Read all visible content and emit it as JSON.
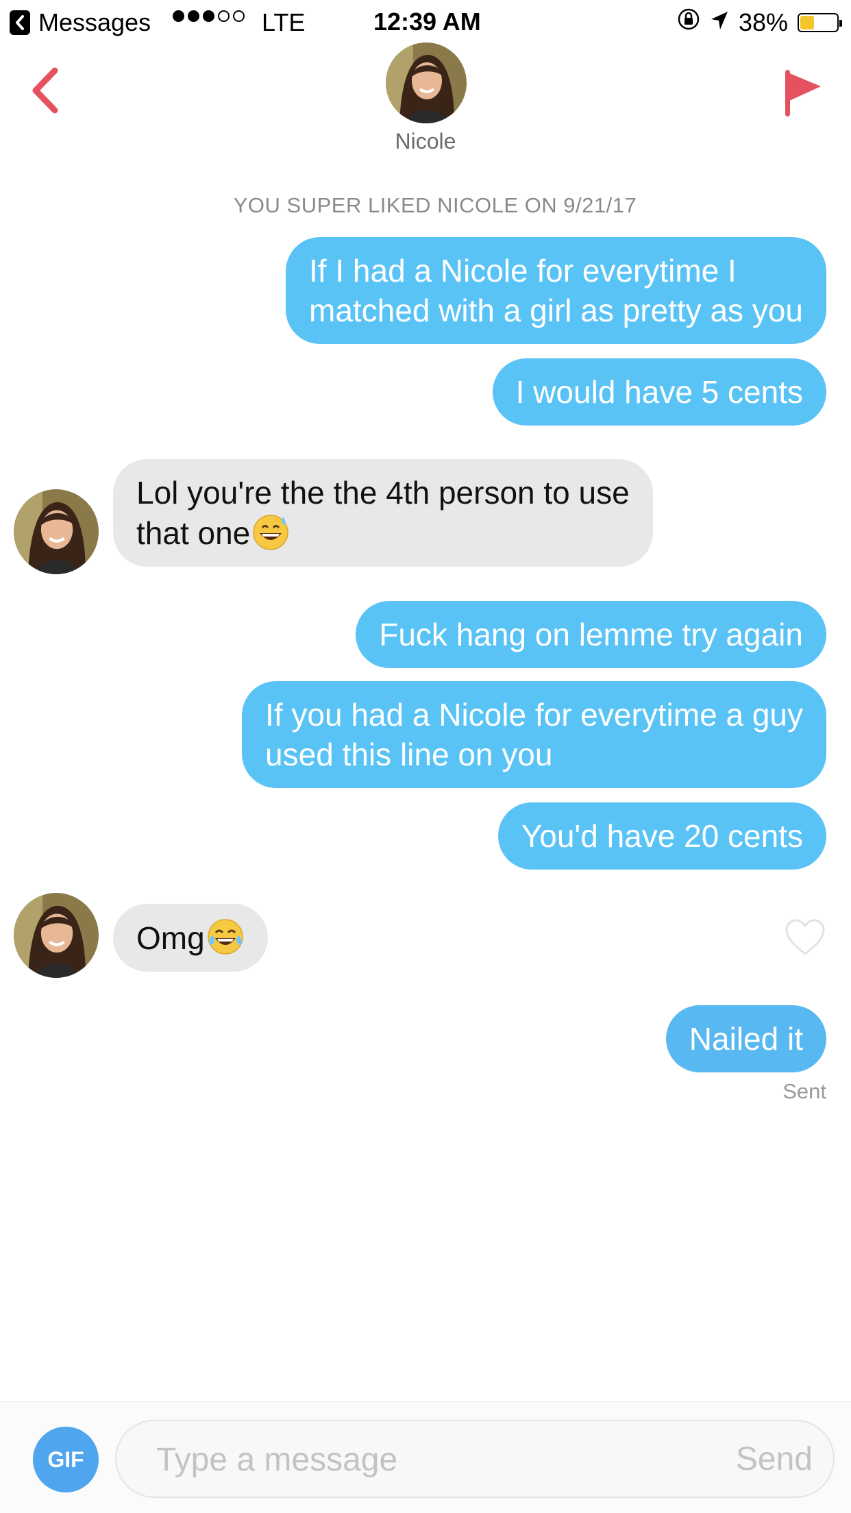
{
  "status_bar": {
    "back_app": "Messages",
    "carrier": "LTE",
    "time": "12:39 AM",
    "battery": "38%",
    "battery_level": 0.38,
    "signal_bars_filled": 3,
    "signal_bars_total": 5
  },
  "header": {
    "name": "Nicole"
  },
  "match_note": "YOU SUPER LIKED NICOLE ON 9/21/17",
  "messages": [
    {
      "from": "me",
      "lines": [
        "If I had a Nicole for everytime I",
        "matched with a girl as pretty as you"
      ]
    },
    {
      "from": "me",
      "lines": [
        "I would have 5 cents"
      ]
    },
    {
      "from": "them",
      "lines": [
        "Lol you're the the 4th person to use",
        "that one"
      ],
      "emoji": "grinning-sweat-emoji"
    },
    {
      "from": "me",
      "lines": [
        "Fuck hang on lemme try again"
      ]
    },
    {
      "from": "me",
      "lines": [
        "If you had a Nicole for everytime a guy",
        "used this line on you"
      ]
    },
    {
      "from": "me",
      "lines": [
        "You'd have 20 cents"
      ]
    },
    {
      "from": "them",
      "lines": [
        "Omg"
      ],
      "emoji": "tears-of-joy-emoji"
    },
    {
      "from": "me",
      "lines": [
        "Nailed it"
      ]
    }
  ],
  "sent_status": "Sent",
  "composer": {
    "gif_label": "GIF",
    "placeholder": "Type a message",
    "send_label": "Send"
  },
  "colors": {
    "sent_bubble": "#5ac3f6",
    "received_bubble": "#e8e8e8",
    "accent_red": "#e4525f",
    "gif_button": "#4fa5ee"
  }
}
